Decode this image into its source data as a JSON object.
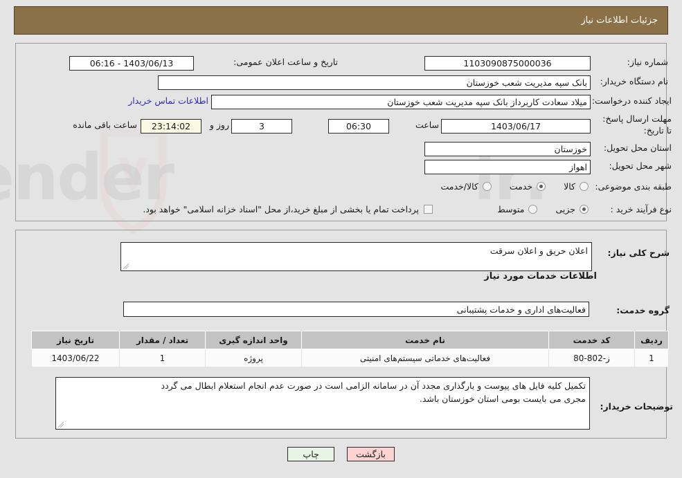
{
  "header": {
    "title": "جزئیات اطلاعات نیاز",
    "bg_color": "#8c7048",
    "text_color": "#ffffff"
  },
  "watermark": {
    "text": "AriaTender.ir",
    "brand": "AriaTender",
    "tld": ".ir"
  },
  "form": {
    "need_number": {
      "label": "شماره نیاز:",
      "value": "1103090875000036"
    },
    "public_announce": {
      "label": "تاریخ و ساعت اعلان عمومی:",
      "value": "1403/06/13 - 06:16"
    },
    "buyer_org": {
      "label": "نام دستگاه خریدار:",
      "value": "بانک سپه مدیریت شعب خوزستان"
    },
    "request_creator": {
      "label": "ایجاد کننده درخواست:",
      "value": "میلاد سعادت کاربرداز بانک سپه مدیریت شعب خوزستان"
    },
    "buyer_contact_link": "اطلاعات تماس خریدار",
    "deadline": {
      "label": "مهلت ارسال پاسخ: تا تاریخ:",
      "date": "1403/06/17",
      "hour_label": "ساعت",
      "hour": "06:30",
      "days": "3",
      "days_label": "روز و",
      "countdown": "23:14:02",
      "remaining_label": "ساعت باقی مانده"
    },
    "province": {
      "label": "استان محل تحویل:",
      "value": "خوزستان"
    },
    "city": {
      "label": "شهر محل تحویل:",
      "value": "اهواز"
    },
    "subject_category": {
      "label": "طبقه بندی موضوعی:",
      "options": [
        {
          "label": "کالا",
          "selected": false
        },
        {
          "label": "خدمت",
          "selected": true
        },
        {
          "label": "کالا/خدمت",
          "selected": false
        }
      ]
    },
    "purchase_process": {
      "label": "نوع فرآیند خرید :",
      "options": [
        {
          "label": "جزیی",
          "selected": true
        },
        {
          "label": "متوسط",
          "selected": false
        }
      ],
      "checkbox": {
        "label": "پرداخت تمام یا بخشی از مبلغ خرید،از محل \"اسناد خزانه اسلامی\" خواهد بود.",
        "checked": false
      }
    },
    "general_description": {
      "label": "شرح کلی نیاز:",
      "value": "اعلان حریق و اعلان سرقت"
    },
    "services_section_title": "اطلاعات خدمات مورد نیاز",
    "service_group": {
      "label": "گروه خدمت:",
      "value": "فعالیت‌های اداری و خدمات پشتیبانی"
    },
    "buyer_notes": {
      "label": "توضیحات خریدار:",
      "line1": "تکمیل کلیه فایل های پیوست و بارگذاری مجدد آن در سامانه الزامی است در صورت عدم انجام استعلام ابطال می گردد",
      "line2": "مجری می بایست بومی استان خوزستان باشد."
    }
  },
  "items_table": {
    "headers": {
      "row": "ردیف",
      "code": "کد خدمت",
      "name": "نام خدمت",
      "unit": "واحد اندازه گیری",
      "qty": "تعداد / مقدار",
      "date": "تاریخ نیاز"
    },
    "rows": [
      {
        "row": "1",
        "code": "ز-802-80",
        "name": "فعالیت‌های خدماتی سیستم‌های امنیتی",
        "unit": "پروژه",
        "qty": "1",
        "date": "1403/06/22"
      }
    ]
  },
  "footer": {
    "print_label": "چاپ",
    "back_label": "بازگشت"
  }
}
